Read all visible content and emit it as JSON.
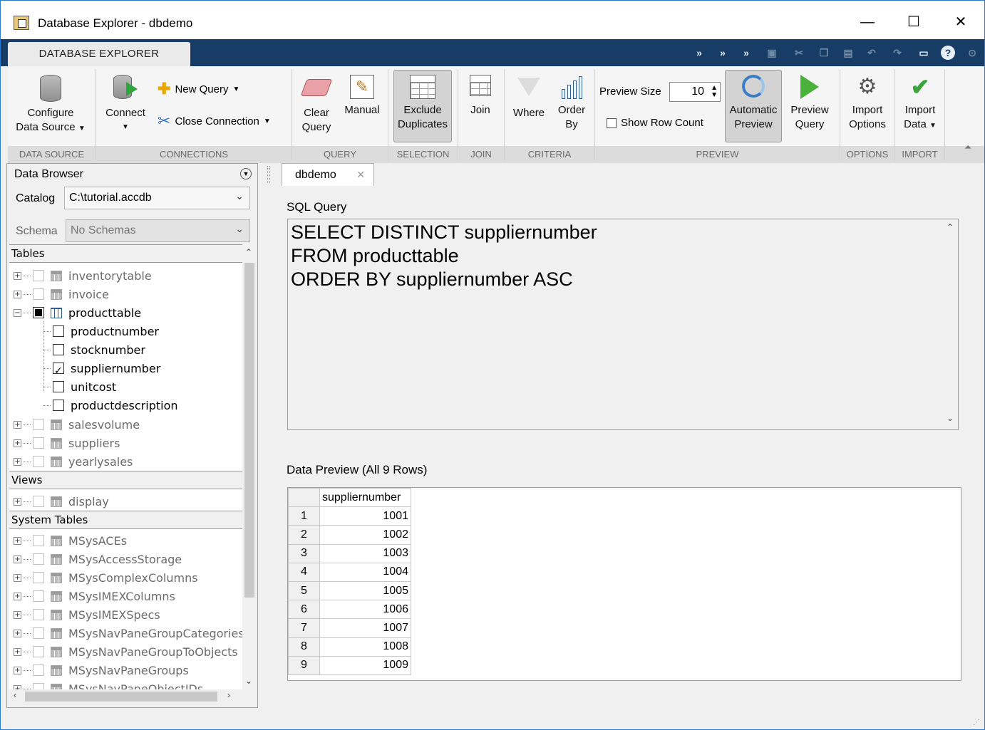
{
  "window": {
    "title": "Database Explorer - dbdemo"
  },
  "toolstrip": {
    "tab": "DATABASE EXPLORER",
    "buttons": {
      "configure": [
        "Configure",
        "Data Source"
      ],
      "connect": "Connect",
      "new_query": "New Query",
      "close_connection": "Close Connection",
      "clear_query": [
        "Clear",
        "Query"
      ],
      "manual": "Manual",
      "exclude_duplicates": [
        "Exclude",
        "Duplicates"
      ],
      "join": "Join",
      "where": "Where",
      "order_by": [
        "Order",
        "By"
      ],
      "preview_size_label": "Preview Size",
      "preview_size_value": "10",
      "show_row_count": "Show Row Count",
      "automatic_preview": [
        "Automatic",
        "Preview"
      ],
      "preview_query": [
        "Preview",
        "Query"
      ],
      "import_options": [
        "Import",
        "Options"
      ],
      "import_data": [
        "Import",
        "Data"
      ]
    },
    "sections": {
      "data_source": "DATA SOURCE",
      "connections": "CONNECTIONS",
      "query": "QUERY",
      "selection": "SELECTION",
      "join": "JOIN",
      "criteria": "CRITERIA",
      "preview": "PREVIEW",
      "options": "OPTIONS",
      "import": "IMPORT"
    }
  },
  "browser": {
    "title": "Data Browser",
    "catalog_label": "Catalog",
    "catalog_value": "C:\\tutorial.accdb",
    "schema_label": "Schema",
    "schema_value": "No Schemas",
    "sections": {
      "tables": "Tables",
      "views": "Views",
      "system_tables": "System Tables"
    },
    "tables": [
      "inventorytable",
      "invoice",
      "producttable",
      "salesvolume",
      "suppliers",
      "yearlysales"
    ],
    "columns": [
      "productnumber",
      "stocknumber",
      "suppliernumber",
      "unitcost",
      "productdescription"
    ],
    "views": [
      "display"
    ],
    "system_tables": [
      "MSysACEs",
      "MSysAccessStorage",
      "MSysComplexColumns",
      "MSysIMEXColumns",
      "MSysIMEXSpecs",
      "MSysNavPaneGroupCategories",
      "MSysNavPaneGroupToObjects",
      "MSysNavPaneGroups",
      "MSysNavPaneObjectIDs"
    ]
  },
  "document": {
    "tab": "dbdemo",
    "sql_label": "SQL Query",
    "sql_lines": [
      "SELECT DISTINCT suppliernumber",
      "FROM producttable",
      "ORDER BY suppliernumber ASC"
    ],
    "preview_label": "Data Preview (All 9 Rows)",
    "column": "suppliernumber",
    "rows": [
      [
        "1",
        "1001"
      ],
      [
        "2",
        "1002"
      ],
      [
        "3",
        "1003"
      ],
      [
        "4",
        "1004"
      ],
      [
        "5",
        "1005"
      ],
      [
        "6",
        "1006"
      ],
      [
        "7",
        "1007"
      ],
      [
        "8",
        "1008"
      ],
      [
        "9",
        "1009"
      ]
    ]
  }
}
